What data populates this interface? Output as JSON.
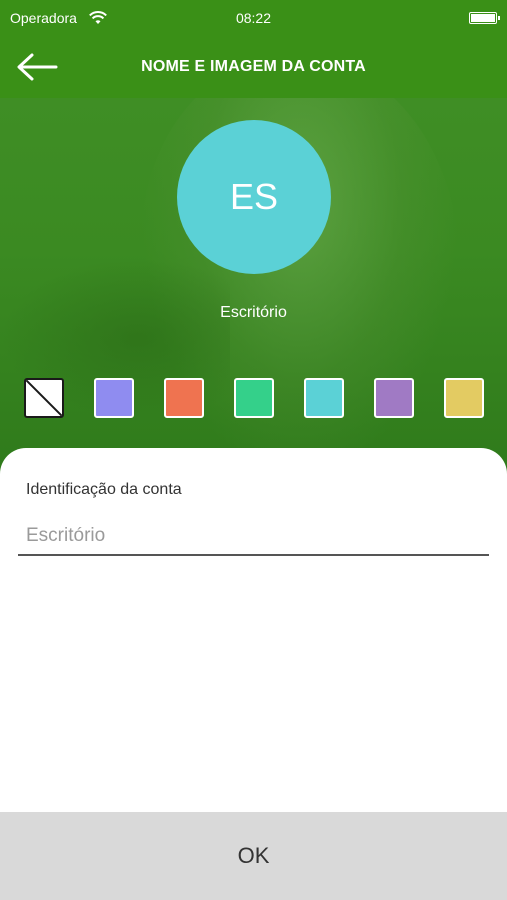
{
  "status_bar": {
    "carrier": "Operadora",
    "time": "08:22"
  },
  "header": {
    "title": "NOME E IMAGEM DA CONTA",
    "back_icon": "arrow-left-icon"
  },
  "avatar": {
    "initials": "ES",
    "color": "#5bd1d6",
    "name": "Escritório"
  },
  "swatches": [
    {
      "name": "none",
      "color": "#ffffff"
    },
    {
      "name": "purple-blue",
      "color": "#8f8cf0"
    },
    {
      "name": "orange",
      "color": "#ef7350"
    },
    {
      "name": "green",
      "color": "#34d08a"
    },
    {
      "name": "cyan",
      "color": "#5bd1d6"
    },
    {
      "name": "purple",
      "color": "#a07ac4"
    },
    {
      "name": "yellow",
      "color": "#e3cb62"
    }
  ],
  "form": {
    "label": "Identificação da conta",
    "placeholder": "Escritório",
    "value": ""
  },
  "ok_label": "OK",
  "colors": {
    "brand_green": "#3a9017",
    "ok_bar": "#d9d9d9"
  }
}
